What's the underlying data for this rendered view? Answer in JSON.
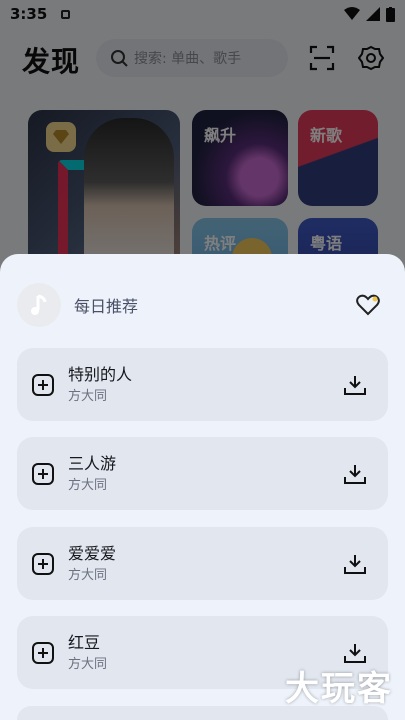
{
  "status_bar": {
    "time": "3:35"
  },
  "header": {
    "title": "发现",
    "search_placeholder": "搜索: 单曲、歌手"
  },
  "tiles": [
    {
      "label": "飙升"
    },
    {
      "label": "新歌"
    },
    {
      "label": "热评"
    },
    {
      "label": "粤语"
    }
  ],
  "sheet": {
    "title": "每日推荐",
    "songs": [
      {
        "name": "特别的人",
        "artist": "方大同"
      },
      {
        "name": "三人游",
        "artist": "方大同"
      },
      {
        "name": "爱爱爱",
        "artist": "方大同"
      },
      {
        "name": "红豆",
        "artist": "方大同"
      }
    ]
  },
  "watermark": "大玩客",
  "colors": {
    "sheet_bg": "#eef3fb",
    "card_bg": "#e1e6ef",
    "overlay": "rgba(0,0,0,0.5)"
  }
}
